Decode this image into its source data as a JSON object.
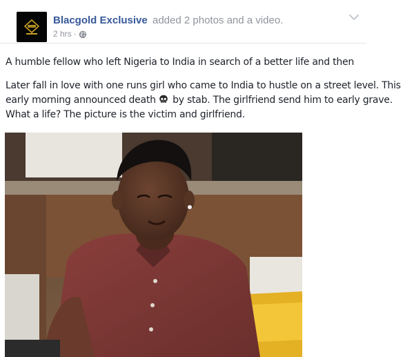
{
  "post": {
    "author": "Blacgold Exclusive",
    "action": "added 2 photos and a video.",
    "timestamp": "2 hrs",
    "separator": "·",
    "privacy_icon": "globe-icon",
    "menu_icon": "chevron-down-icon",
    "text_line_1": "A humble fellow who left Nigeria to India in search of a better life and then",
    "text_line_2_before": "Later fall in love with one runs girl who came to India to hustle on a street level. This early morning announced death",
    "text_line_2_emoji": "skull-icon",
    "text_line_2_after": " by stab. The girlfriend send him to early grave. What a life? The picture is the victim and girlfriend.",
    "photo": "photo of a young man in a maroon shirt seated at a table"
  },
  "colors": {
    "author_link": "#365899",
    "meta_text": "#90949c",
    "body_text": "#1d2129",
    "divider": "#e3e5ea"
  }
}
